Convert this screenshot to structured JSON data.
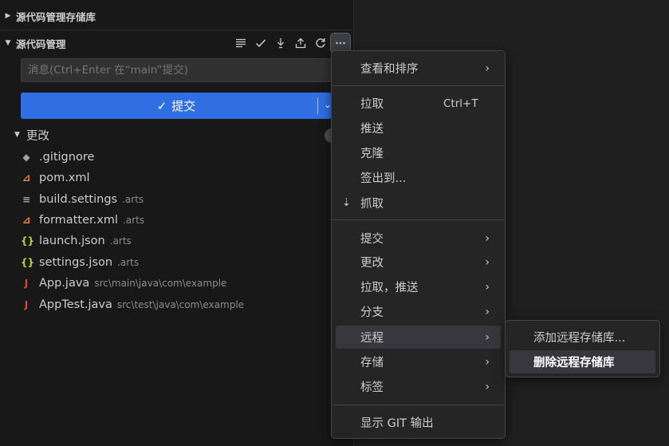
{
  "colors": {
    "accent": "#2f6fe3",
    "menu_bg": "#252526",
    "highlight": "#37373d"
  },
  "sections": {
    "repos_title": "源代码管理存储库",
    "scm_title": "源代码管理"
  },
  "toolbar_icons": [
    "view-as-tree-icon",
    "commit-check-icon",
    "fetch-down-icon",
    "publish-up-icon",
    "refresh-icon",
    "more-actions-icon"
  ],
  "commit": {
    "placeholder": "消息(Ctrl+Enter 在“main”提交)",
    "button_label": "提交",
    "check_glyph": "✓",
    "chevron_glyph": "⌄"
  },
  "changes": {
    "label": "更改",
    "files": [
      {
        "name": ".gitignore",
        "path": "",
        "icon": "git-icon"
      },
      {
        "name": "pom.xml",
        "path": "",
        "icon": "rss-icon"
      },
      {
        "name": "build.settings",
        "path": ".arts",
        "icon": "lines-icon"
      },
      {
        "name": "formatter.xml",
        "path": ".arts",
        "icon": "rss-icon"
      },
      {
        "name": "launch.json",
        "path": ".arts",
        "icon": "json-icon"
      },
      {
        "name": "settings.json",
        "path": ".arts",
        "icon": "json-icon"
      },
      {
        "name": "App.java",
        "path": "src\\main\\java\\com\\example",
        "icon": "java-icon"
      },
      {
        "name": "AppTest.java",
        "path": "src\\test\\java\\com\\example",
        "icon": "java-icon"
      }
    ]
  },
  "menu": {
    "view_sort": "查看和排序",
    "pull": "拉取",
    "pull_shortcut": "Ctrl+T",
    "push": "推送",
    "clone": "克隆",
    "checkout": "签出到...",
    "fetch": "抓取",
    "commit": "提交",
    "changes": "更改",
    "pull_push": "拉取，推送",
    "branch": "分支",
    "remote": "远程",
    "stash": "存储",
    "tags": "标签",
    "show_git_output": "显示 GIT 输出",
    "arrow": "›"
  },
  "submenu": {
    "add_remote": "添加远程存储库...",
    "remove_remote": "删除远程存储库"
  }
}
